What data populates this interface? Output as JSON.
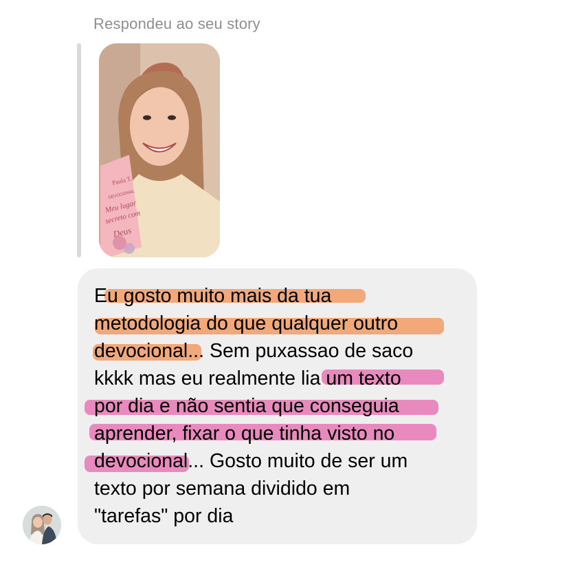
{
  "reply_label": "Respondeu ao seu story",
  "story": {
    "book_title_lines": [
      "Paula T.",
      "DEVOCIONAL",
      "Meu lugar",
      "secreto com",
      "Deus"
    ]
  },
  "message": {
    "lines": [
      "Eu gosto muito mais da tua",
      "metodologia do que qualquer outro",
      "devocional... Sem puxassao de saco",
      "kkkk mas eu realmente lia um texto",
      "por dia e não sentia que conseguia",
      "aprender, fixar o que tinha visto no",
      "devocional... Gosto muito de ser um",
      "texto por semana dividido em",
      "\"tarefas\" por dia"
    ]
  },
  "highlight_colors": {
    "orange": "#f2a06b",
    "pink": "#e77eb7"
  },
  "avatar": {
    "icon": "profile-photo-avatar"
  }
}
